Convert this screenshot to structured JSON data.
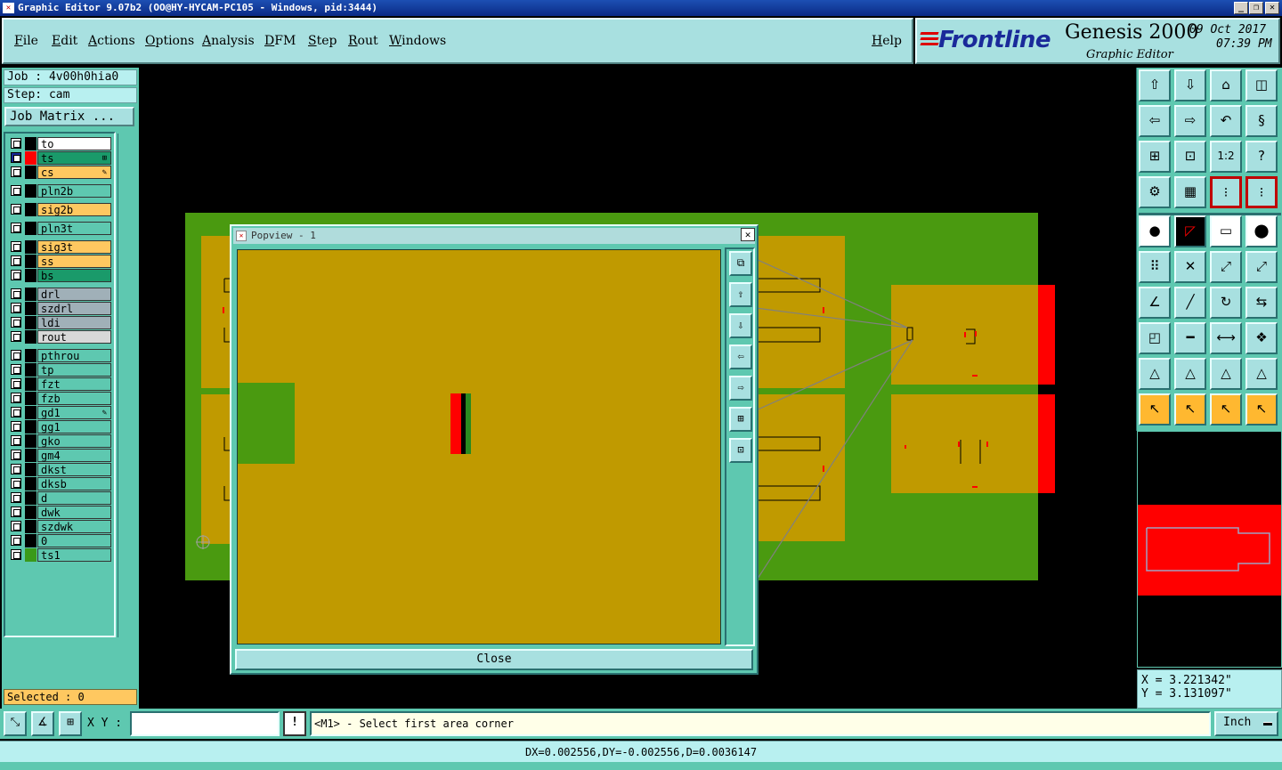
{
  "window": {
    "title": "Graphic Editor 9.07b2 (OO@HY-HYCAM-PC105 - Windows, pid:3444)"
  },
  "menu": {
    "items": [
      "File",
      "Edit",
      "Actions",
      "Options",
      "Analysis",
      "DFM",
      "Step",
      "Rout",
      "Windows"
    ],
    "help": "Help"
  },
  "brand": {
    "logo": "Frontline",
    "product": "Genesis 2000",
    "subtitle": "Graphic Editor",
    "date": "09 Oct 2017",
    "time": "07:39 PM"
  },
  "job": {
    "job_line": "Job : 4v00h0hia0",
    "step_line": "Step: cam",
    "matrix_button": "Job Matrix ..."
  },
  "layers": [
    {
      "name": "to",
      "bg": "#ffffff",
      "color": "#000000",
      "mark": ""
    },
    {
      "name": "ts",
      "bg": "#1a9a6a",
      "color": "#ff0000",
      "mark": "⊞",
      "checked": true
    },
    {
      "name": "cs",
      "bg": "#ffc860",
      "color": "#000000",
      "mark": "✎"
    },
    {
      "name": "pln2b",
      "bg": "#5ec8b0",
      "color": "#000000",
      "mark": ""
    },
    {
      "name": "sig2b",
      "bg": "#ffc860",
      "color": "#000000",
      "mark": ""
    },
    {
      "name": "pln3t",
      "bg": "#5ec8b0",
      "color": "#000000",
      "mark": ""
    },
    {
      "name": "sig3t",
      "bg": "#ffc860",
      "color": "#000000",
      "mark": ""
    },
    {
      "name": "ss",
      "bg": "#ffc860",
      "color": "#000000",
      "mark": ""
    },
    {
      "name": "bs",
      "bg": "#1a9a6a",
      "color": "#000000",
      "mark": ""
    },
    {
      "name": "drl",
      "bg": "#a0b0b8",
      "color": "#000000",
      "mark": ""
    },
    {
      "name": "szdrl",
      "bg": "#a0b0b8",
      "color": "#000000",
      "mark": ""
    },
    {
      "name": "ldi",
      "bg": "#a0b0b8",
      "color": "#000000",
      "mark": ""
    },
    {
      "name": "rout",
      "bg": "#d8d8d8",
      "color": "#000000",
      "mark": ""
    },
    {
      "name": "pthrou",
      "bg": "#5ec8b0",
      "color": "#000000",
      "mark": ""
    },
    {
      "name": "tp",
      "bg": "#5ec8b0",
      "color": "#000000",
      "mark": ""
    },
    {
      "name": "fzt",
      "bg": "#5ec8b0",
      "color": "#000000",
      "mark": ""
    },
    {
      "name": "fzb",
      "bg": "#5ec8b0",
      "color": "#000000",
      "mark": ""
    },
    {
      "name": "gd1",
      "bg": "#5ec8b0",
      "color": "#000000",
      "mark": "✎"
    },
    {
      "name": "gg1",
      "bg": "#5ec8b0",
      "color": "#000000",
      "mark": ""
    },
    {
      "name": "gko",
      "bg": "#5ec8b0",
      "color": "#000000",
      "mark": ""
    },
    {
      "name": "gm4",
      "bg": "#5ec8b0",
      "color": "#000000",
      "mark": ""
    },
    {
      "name": "dkst",
      "bg": "#5ec8b0",
      "color": "#000000",
      "mark": ""
    },
    {
      "name": "dksb",
      "bg": "#5ec8b0",
      "color": "#000000",
      "mark": ""
    },
    {
      "name": "d",
      "bg": "#5ec8b0",
      "color": "#000000",
      "mark": ""
    },
    {
      "name": "dwk",
      "bg": "#5ec8b0",
      "color": "#000000",
      "mark": ""
    },
    {
      "name": "szdwk",
      "bg": "#5ec8b0",
      "color": "#000000",
      "mark": ""
    },
    {
      "name": "0",
      "bg": "#5ec8b0",
      "color": "#000000",
      "mark": ""
    },
    {
      "name": "ts1",
      "bg": "#5ec8b0",
      "color": "#3a9a1a",
      "mark": ""
    }
  ],
  "selected": "Selected : 0",
  "popview": {
    "title": "Popview - 1",
    "close_label": "Close"
  },
  "coords": {
    "x": "X = 3.221342\"",
    "y": "Y = 3.131097\""
  },
  "command": {
    "xy_label": "X Y :",
    "xy_value": "",
    "prompt": "<M1> - Select first area corner",
    "unit": "Inch"
  },
  "status": "DX=0.002556,DY=-0.002556,D=0.0036147",
  "colors": {
    "panel": "#5ec8b0",
    "board_green": "#4a9a10",
    "copper": "#c09a00",
    "highlight_red": "#ff0000"
  }
}
